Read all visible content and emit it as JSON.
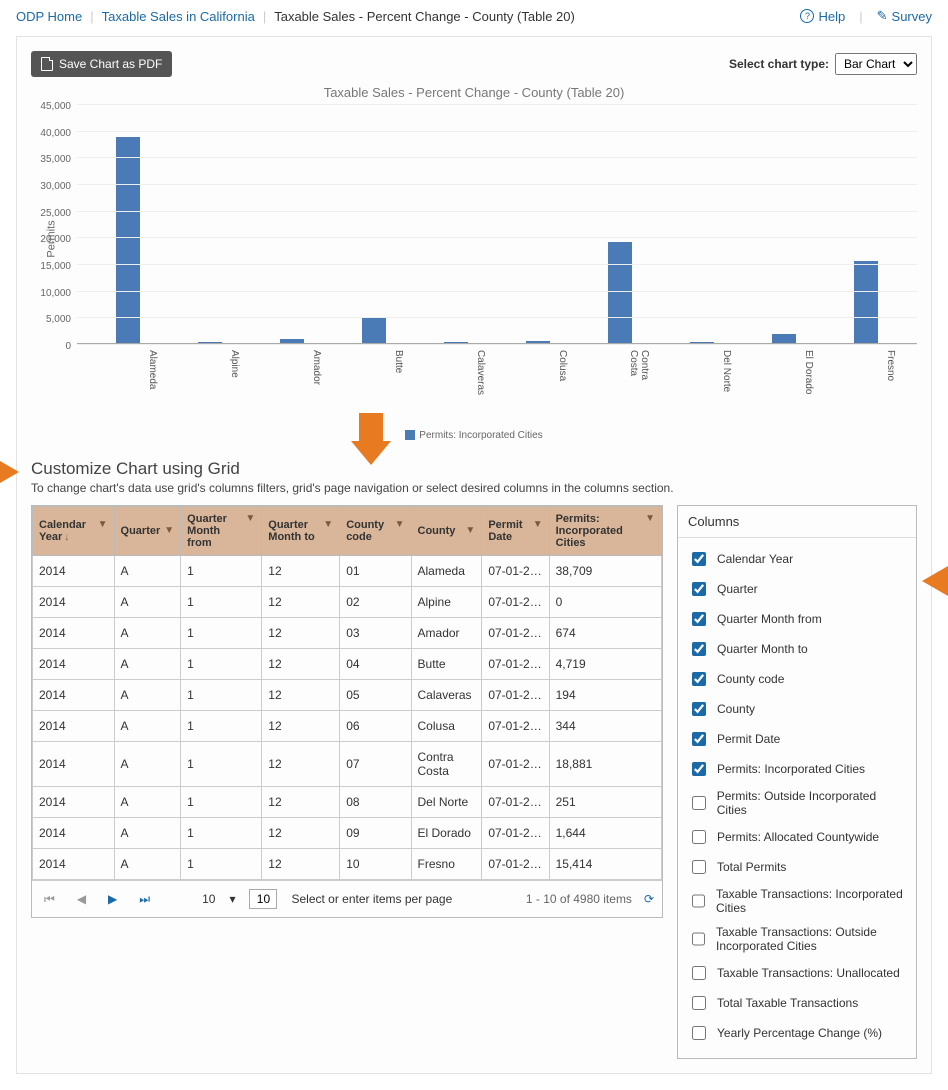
{
  "breadcrumb": {
    "home": "ODP Home",
    "mid": "Taxable Sales in California",
    "current": "Taxable Sales - Percent Change - County (Table 20)"
  },
  "toplinks": {
    "help": "Help",
    "survey": "Survey"
  },
  "toolbar": {
    "save_pdf": "Save Chart as PDF",
    "chart_type_label": "Select chart type:",
    "chart_type_value": "Bar Chart"
  },
  "chart_data": {
    "type": "bar",
    "title": "Taxable Sales - Percent Change - County (Table 20)",
    "ylabel": "Permits",
    "ylim": [
      0,
      45000
    ],
    "ytick_step": 5000,
    "categories": [
      "Alameda",
      "Alpine",
      "Amador",
      "Butte",
      "Calaveras",
      "Colusa",
      "Contra Costa",
      "Del Norte",
      "El Dorado",
      "Fresno"
    ],
    "values": [
      38709,
      0,
      674,
      4719,
      194,
      344,
      18881,
      251,
      1644,
      15414
    ],
    "legend": "Permits: Incorporated Cities"
  },
  "customize": {
    "title": "Customize Chart using Grid",
    "sub": "To change chart's data use grid's columns filters, grid's page navigation or select desired columns in the columns section."
  },
  "grid": {
    "headers": [
      "Calendar Year",
      "Quarter",
      "Quarter Month from",
      "Quarter Month to",
      "County code",
      "County",
      "Permit Date",
      "Permits: Incorporated Cities"
    ],
    "sort_col": 0,
    "sort_dir": "↓",
    "rows": [
      [
        "2014",
        "A",
        "1",
        "12",
        "01",
        "Alameda",
        "07-01-2…",
        "38,709"
      ],
      [
        "2014",
        "A",
        "1",
        "12",
        "02",
        "Alpine",
        "07-01-2…",
        "0"
      ],
      [
        "2014",
        "A",
        "1",
        "12",
        "03",
        "Amador",
        "07-01-2…",
        "674"
      ],
      [
        "2014",
        "A",
        "1",
        "12",
        "04",
        "Butte",
        "07-01-2…",
        "4,719"
      ],
      [
        "2014",
        "A",
        "1",
        "12",
        "05",
        "Calaveras",
        "07-01-2…",
        "194"
      ],
      [
        "2014",
        "A",
        "1",
        "12",
        "06",
        "Colusa",
        "07-01-2…",
        "344"
      ],
      [
        "2014",
        "A",
        "1",
        "12",
        "07",
        "Contra Costa",
        "07-01-2…",
        "18,881"
      ],
      [
        "2014",
        "A",
        "1",
        "12",
        "08",
        "Del Norte",
        "07-01-2…",
        "251"
      ],
      [
        "2014",
        "A",
        "1",
        "12",
        "09",
        "El Dorado",
        "07-01-2…",
        "1,644"
      ],
      [
        "2014",
        "A",
        "1",
        "12",
        "10",
        "Fresno",
        "07-01-2…",
        "15,414"
      ]
    ]
  },
  "pager": {
    "page_size_display": "10",
    "page_size_input": "10",
    "per_page_text": "Select or enter items per page",
    "range_text": "1 - 10 of 4980 items"
  },
  "columns": {
    "title": "Columns",
    "items": [
      {
        "label": "Calendar Year",
        "checked": true
      },
      {
        "label": "Quarter",
        "checked": true
      },
      {
        "label": "Quarter Month from",
        "checked": true
      },
      {
        "label": "Quarter Month to",
        "checked": true
      },
      {
        "label": "County code",
        "checked": true
      },
      {
        "label": "County",
        "checked": true
      },
      {
        "label": "Permit Date",
        "checked": true
      },
      {
        "label": "Permits: Incorporated Cities",
        "checked": true
      },
      {
        "label": "Permits: Outside Incorporated Cities",
        "checked": false
      },
      {
        "label": "Permits: Allocated Countywide",
        "checked": false
      },
      {
        "label": "Total Permits",
        "checked": false
      },
      {
        "label": "Taxable Transactions: Incorporated Cities",
        "checked": false
      },
      {
        "label": "Taxable Transactions: Outside Incorporated Cities",
        "checked": false
      },
      {
        "label": "Taxable Transactions: Unallocated",
        "checked": false
      },
      {
        "label": "Total Taxable Transactions",
        "checked": false
      },
      {
        "label": "Yearly Percentage Change (%)",
        "checked": false
      }
    ]
  }
}
